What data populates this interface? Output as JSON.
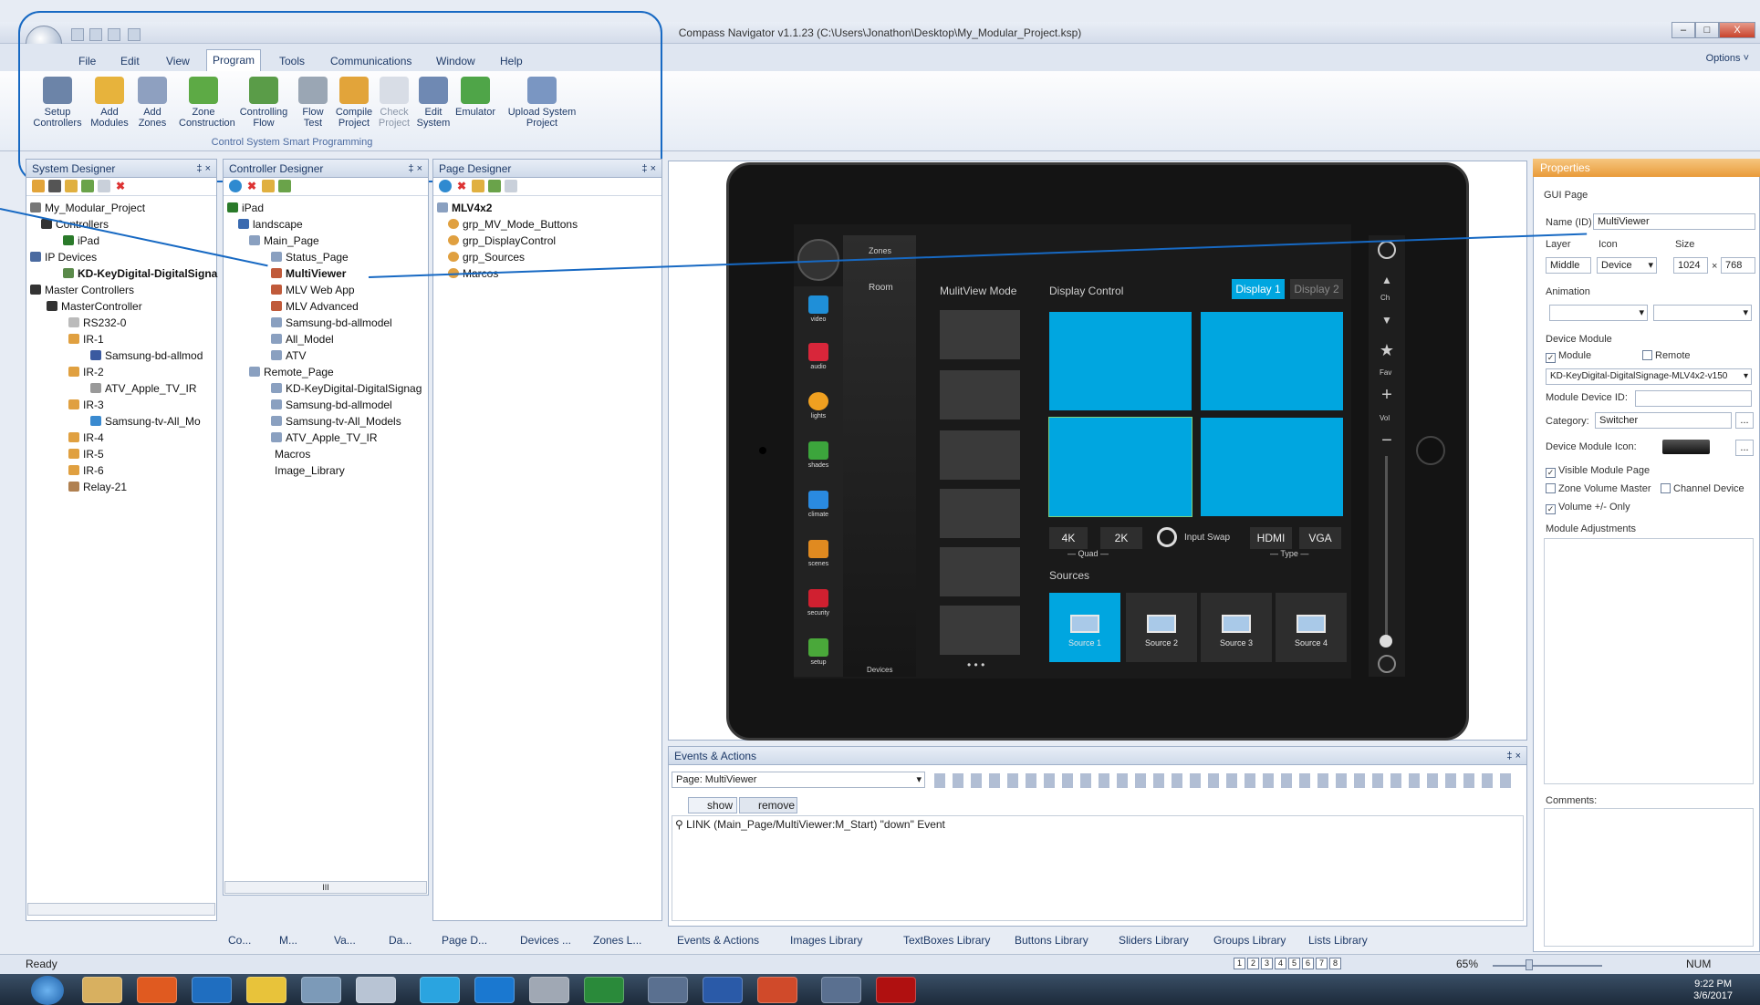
{
  "window": {
    "title": "Compass Navigator  v1.1.23 (C:\\Users\\Jonathon\\Desktop\\My_Modular_Project.ksp)",
    "options": "Options ˅"
  },
  "menu": [
    "File",
    "Edit",
    "View",
    "Program",
    "Tools",
    "Communications",
    "Window",
    "Help"
  ],
  "menu_active": "Program",
  "ribbon": {
    "buttons": [
      {
        "l1": "Setup",
        "l2": "Controllers"
      },
      {
        "l1": "Add",
        "l2": "Modules"
      },
      {
        "l1": "Add",
        "l2": "Zones"
      },
      {
        "l1": "Zone",
        "l2": "Construction"
      },
      {
        "l1": "Controlling",
        "l2": "Flow"
      },
      {
        "l1": "Flow",
        "l2": "Test"
      },
      {
        "l1": "Compile",
        "l2": "Project"
      },
      {
        "l1": "Check",
        "l2": "Project"
      },
      {
        "l1": "Edit",
        "l2": "System"
      },
      {
        "l1": "Emulator",
        "l2": ""
      },
      {
        "l1": "Upload System",
        "l2": "Project"
      }
    ],
    "group": "Control System Smart Programming"
  },
  "system_designer": {
    "title": "System Designer",
    "pin": "‡ ×",
    "nodes": [
      "My_Modular_Project",
      "Controllers",
      "iPad",
      "IP Devices",
      "KD-KeyDigital-DigitalSigna",
      "Master Controllers",
      "MasterController",
      "RS232-0",
      "IR-1",
      "Samsung-bd-allmod",
      "IR-2",
      "ATV_Apple_TV_IR",
      "IR-3",
      "Samsung-tv-All_Mo",
      "IR-4",
      "IR-5",
      "IR-6",
      "Relay-21"
    ],
    "tabs": [
      "Co...",
      "M...",
      "Va...",
      "Da..."
    ]
  },
  "controller_designer": {
    "title": "Controller Designer",
    "pin": "‡ ×",
    "nodes": [
      "iPad",
      "landscape",
      "Main_Page",
      "Status_Page",
      "MultiViewer",
      "MLV Web App",
      "MLV Advanced",
      "Samsung-bd-allmodel",
      "All_Model",
      "ATV",
      "Remote_Page",
      "KD-KeyDigital-DigitalSignag",
      "Samsung-bd-allmodel",
      "Samsung-tv-All_Models",
      "ATV_Apple_TV_IR",
      "Macros",
      "Image_Library"
    ],
    "hscroll": "III"
  },
  "page_designer": {
    "title": "Page Designer",
    "pin": "‡ ×",
    "nodes": [
      "MLV4x2",
      "grp_MV_Mode_Buttons",
      "grp_DisplayControl",
      "grp_Sources",
      "Marcos"
    ],
    "tabs": [
      "Page D...",
      "Devices ...",
      "Zones L..."
    ]
  },
  "device": {
    "sidebar": [
      "video",
      "audio",
      "lights",
      "shades",
      "climate",
      "scenes",
      "security",
      "setup"
    ],
    "zones_tab": "Zones",
    "room": "Room",
    "devices": "Devices",
    "mv_title": "MulitView Mode",
    "dc_title": "Display Control",
    "display1": "Display 1",
    "display2": "Display 2",
    "btn_4k": "4K",
    "btn_2k": "2K",
    "quad": "— Quad —",
    "input_swap": "Input Swap",
    "hdmi": "HDMI",
    "vga": "VGA",
    "type": "— Type —",
    "sources_title": "Sources",
    "sources": [
      "Source 1",
      "Source 2",
      "Source 3",
      "Source 4"
    ],
    "right": [
      "Ch",
      "Fav",
      "Vol"
    ],
    "dots": "• • •"
  },
  "properties": {
    "title": "Properties",
    "section": "GUI Page",
    "name_label": "Name (ID)",
    "name_value": "MultiViewer",
    "layer_label": "Layer",
    "layer_value": "Middle",
    "icon_label": "Icon",
    "icon_value": "Device",
    "size_label": "Size",
    "width": "1024",
    "x": "×",
    "height": "768",
    "animation": "Animation",
    "device_module": "Device Module",
    "module": "Module",
    "remote": "Remote",
    "module_select": "KD-KeyDigital-DigitalSignage-MLV4x2-v150",
    "module_device_id": "Module Device ID:",
    "category_label": "Category:",
    "category_value": "Switcher",
    "device_module_icon": "Device Module Icon:",
    "visible_module_page": "Visible Module Page",
    "zone_volume_master": "Zone Volume Master",
    "channel_device": "Channel Device",
    "volume_only": "Volume +/- Only",
    "module_adjustments": "Module Adjustments",
    "comments": "Comments:",
    "browse": "..."
  },
  "events": {
    "title": "Events & Actions",
    "page_select": "Page: MultiViewer",
    "show": "show",
    "remove": "remove",
    "line1": "LINK    (Main_Page/MultiViewer:M_Start) \"down\" Event",
    "tabs": [
      "Events & Actions",
      "Images Library",
      "TextBoxes Library",
      "Buttons Library",
      "Sliders Library",
      "Groups Library",
      "Lists Library"
    ]
  },
  "status": {
    "text": "Ready",
    "zoom": "65%",
    "num": "NUM",
    "pages": [
      "1",
      "2",
      "3",
      "4",
      "5",
      "6",
      "7",
      "8"
    ]
  },
  "clock": {
    "time": "9:22 PM",
    "date": "3/6/2017"
  },
  "colors": {
    "accent_blue": "#00a6e0",
    "props_header": "#e99b3a",
    "annotation": "#1769c3"
  }
}
